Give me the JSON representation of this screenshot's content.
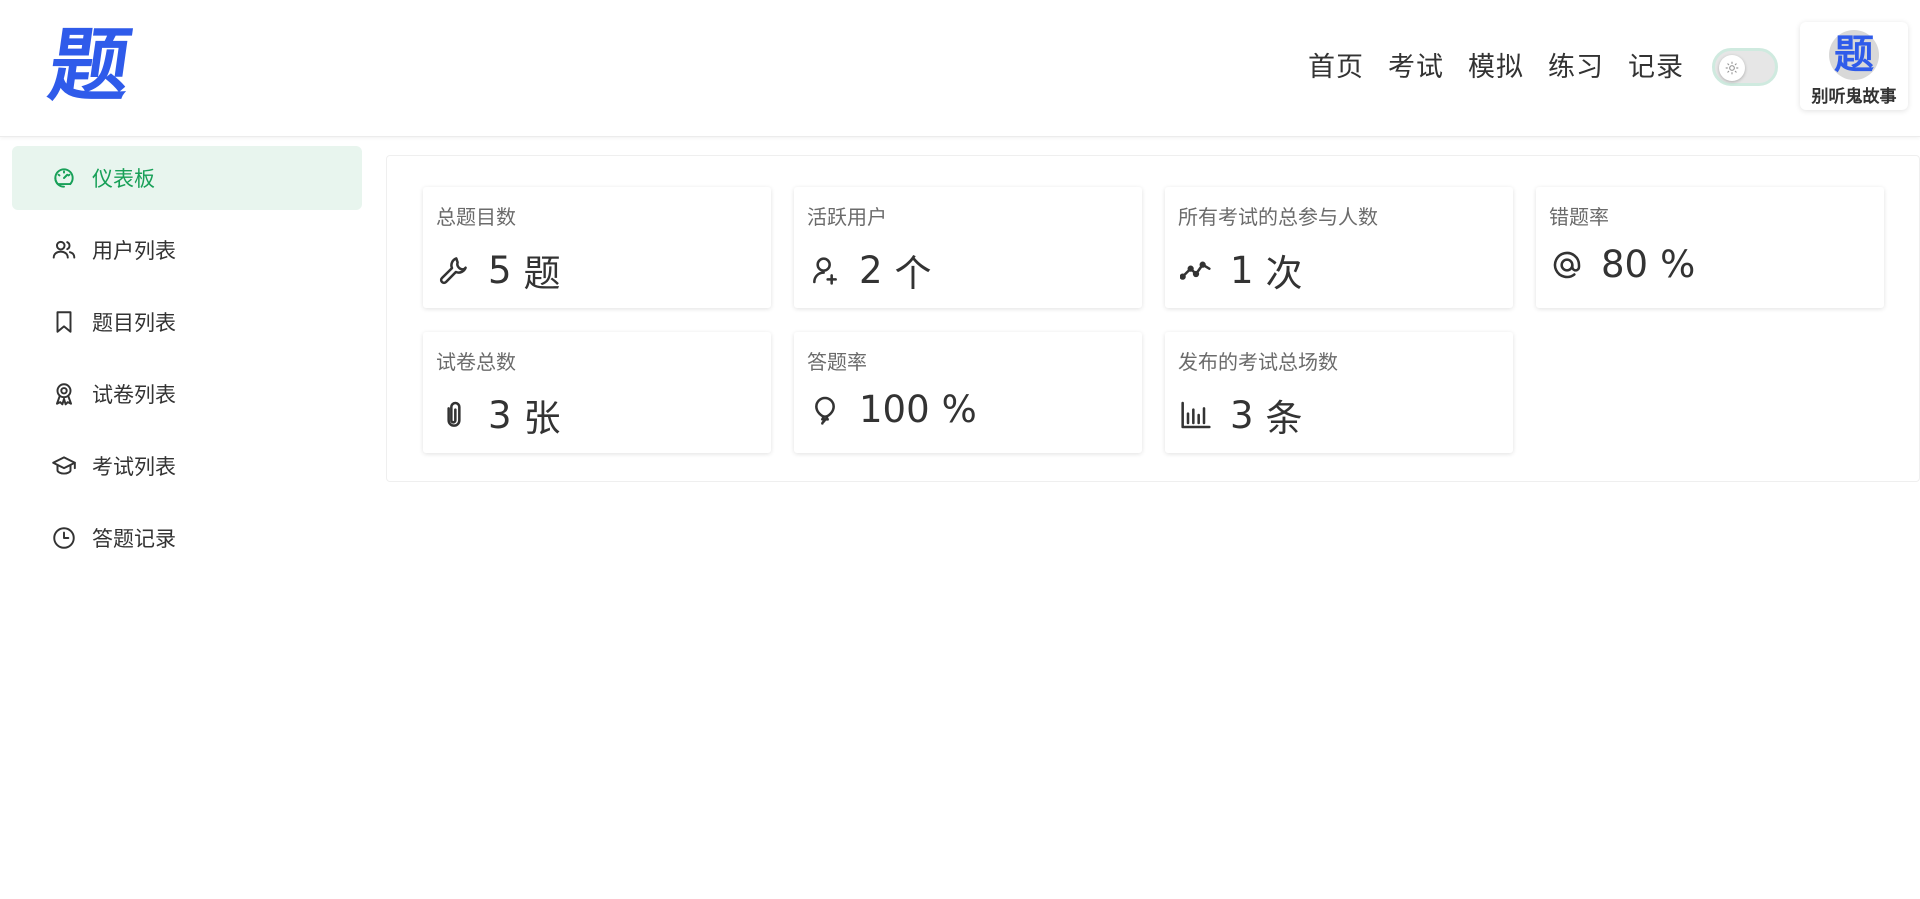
{
  "header": {
    "logo_text": "题",
    "nav": [
      "首页",
      "考试",
      "模拟",
      "练习",
      "记录"
    ],
    "theme_toggle_icon": "sun-icon",
    "user": {
      "avatar_text": "题",
      "name": "别听鬼故事"
    }
  },
  "sidebar": {
    "items": [
      {
        "label": "仪表板",
        "icon": "dashboard-icon",
        "active": true
      },
      {
        "label": "用户列表",
        "icon": "users-icon",
        "active": false
      },
      {
        "label": "题目列表",
        "icon": "bookmark-icon",
        "active": false
      },
      {
        "label": "试卷列表",
        "icon": "award-icon",
        "active": false
      },
      {
        "label": "考试列表",
        "icon": "graduation-cap-icon",
        "active": false
      },
      {
        "label": "答题记录",
        "icon": "clock-icon",
        "active": false
      }
    ]
  },
  "stats": [
    {
      "title": "总题目数",
      "value": "5",
      "unit": "题",
      "icon": "wrench-icon"
    },
    {
      "title": "活跃用户",
      "value": "2",
      "unit": "个",
      "icon": "user-plus-icon"
    },
    {
      "title": "所有考试的总参与人数",
      "value": "1",
      "unit": "次",
      "icon": "trend-line-icon"
    },
    {
      "title": "错题率",
      "value": "80",
      "unit": "%",
      "icon": "at-sign-icon"
    },
    {
      "title": "试卷总数",
      "value": "3",
      "unit": "张",
      "icon": "paperclip-icon"
    },
    {
      "title": "答题率",
      "value": "100",
      "unit": "%",
      "icon": "balloon-icon"
    },
    {
      "title": "发布的考试总场数",
      "value": "3",
      "unit": "条",
      "icon": "bar-chart-icon"
    }
  ],
  "colors": {
    "accent": "#18a058",
    "active_bg": "#e8f5ee",
    "brand": "#2f5bea"
  }
}
